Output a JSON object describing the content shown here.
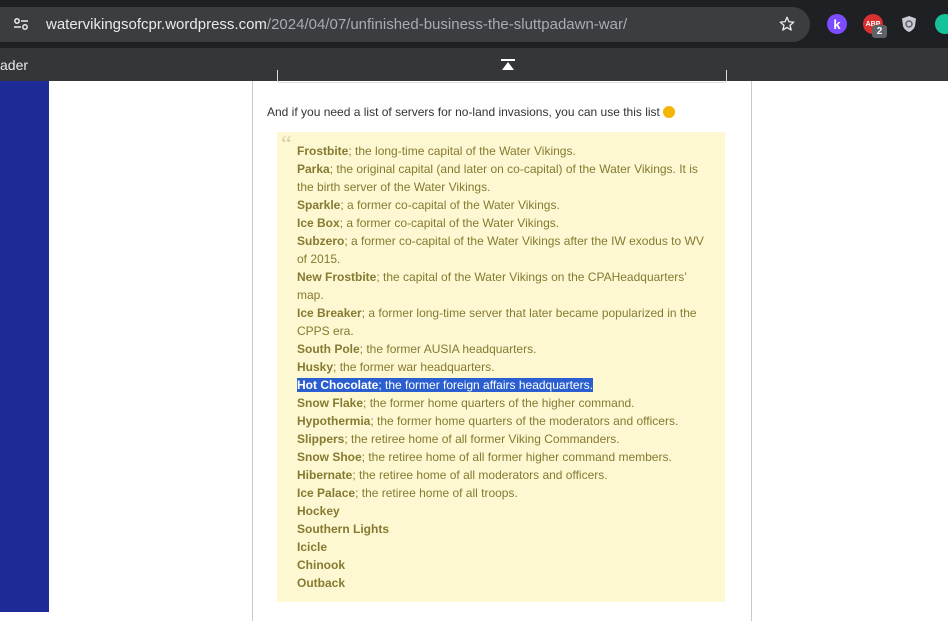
{
  "browser": {
    "url_host": "watervikingsofcpr.wordpress.com",
    "url_path": "/2024/04/07/unfinished-business-the-sluttpadawn-war/",
    "extensions": [
      {
        "name": "k-extension",
        "label": "k"
      },
      {
        "name": "adblock-extension",
        "label": "ABP",
        "badge": "2"
      },
      {
        "name": "shield-extension"
      },
      {
        "name": "grammarly-extension"
      }
    ],
    "bookmark_fragment": "ader"
  },
  "article": {
    "intro": "And if you need a list of servers for no-land invasions, you can use this list",
    "servers": [
      {
        "name": "Frostbite",
        "desc": "; the long-time capital of the Water Vikings."
      },
      {
        "name": "Parka",
        "desc": "; the original capital (and later on co-capital) of the Water Vikings. It is the birth server of the Water Vikings."
      },
      {
        "name": "Sparkle",
        "desc": "; a former co-capital of the Water Vikings."
      },
      {
        "name": "Ice Box",
        "desc": "; a former co-capital of the Water Vikings."
      },
      {
        "name": "Subzero",
        "desc": "; a former co-capital of the Water Vikings after the IW exodus to WV of 2015."
      },
      {
        "name": "New Frostbite",
        "desc": "; the capital of the Water Vikings on the CPAHeadquarters’ map."
      },
      {
        "name": "Ice Breaker",
        "desc": "; a former long-time server that later became popularized in the CPPS era."
      },
      {
        "name": "South Pole",
        "desc": "; the former AUSIA headquarters."
      },
      {
        "name": "Husky",
        "desc": "; the former war headquarters."
      },
      {
        "name": "Hot Chocolate",
        "desc": "; the former foreign affairs headquarters.",
        "selected": true
      },
      {
        "name": "Snow Flake",
        "desc": "; the former home quarters of the higher command."
      },
      {
        "name": "Hypothermia",
        "desc": "; the former home quarters of the moderators and officers."
      },
      {
        "name": "Slippers",
        "desc": "; the retiree home of all former Viking Commanders."
      },
      {
        "name": "Snow Shoe",
        "desc": "; the retiree home of all former higher command members."
      },
      {
        "name": "Hibernate",
        "desc": "; the retiree home of all moderators and officers."
      },
      {
        "name": "Ice Palace",
        "desc": "; the retiree home of all troops."
      },
      {
        "name": "Hockey",
        "desc": ""
      },
      {
        "name": "Southern Lights",
        "desc": ""
      },
      {
        "name": "Icicle",
        "desc": ""
      },
      {
        "name": "Chinook",
        "desc": ""
      },
      {
        "name": "Outback",
        "desc": ""
      }
    ]
  },
  "colors": {
    "selection": "#2b5fd0",
    "quote_background": "#fdf8d2",
    "quote_text": "#857a30",
    "left_stripe": "#1f2a99"
  }
}
